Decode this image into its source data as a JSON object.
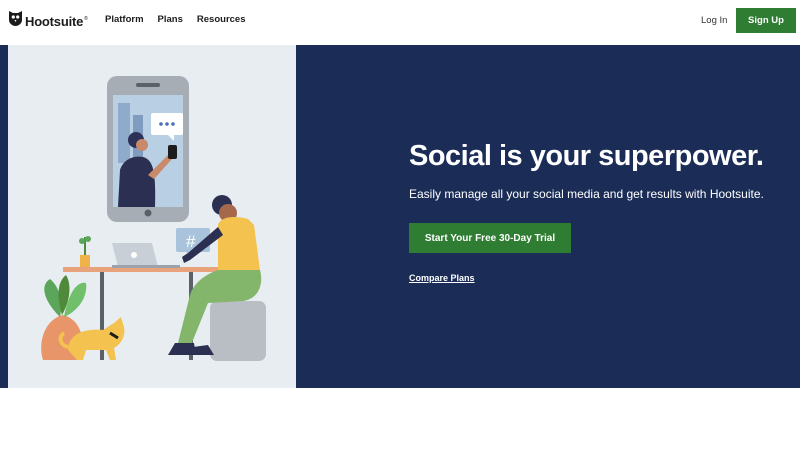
{
  "header": {
    "logo_text": "Hootsuite",
    "logo_tm": "®",
    "nav": [
      {
        "label": "Platform"
      },
      {
        "label": "Plans"
      },
      {
        "label": "Resources"
      }
    ],
    "login_label": "Log In",
    "signup_label": "Sign Up"
  },
  "hero": {
    "headline": "Social is your superpower.",
    "subhead": "Easily manage all your social media and get results with Hootsuite.",
    "cta_label": "Start Your Free 30-Day Trial",
    "compare_label": "Compare Plans",
    "illustration_hashtag": "#"
  },
  "colors": {
    "brand_green": "#2e7d32",
    "hero_navy": "#1b2d57",
    "illustration_bg": "#e8edf2"
  }
}
